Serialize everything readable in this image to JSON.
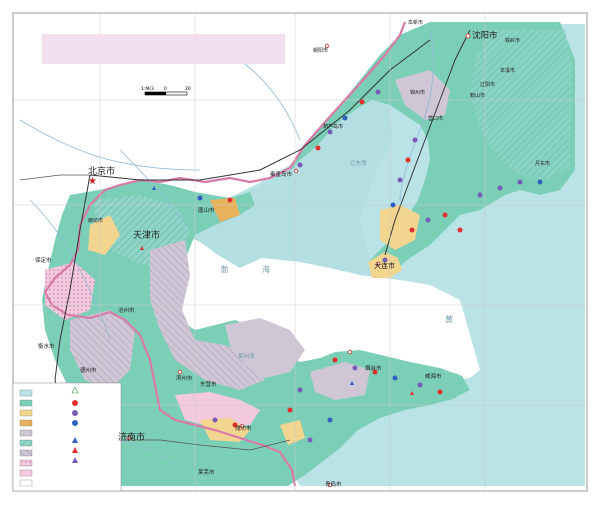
{
  "colors": {
    "sea": "#b9e3e6",
    "land_white": "#ffffff",
    "green": "#7ccfb7",
    "teal_hatch": "#8fd4c7",
    "grey_purple": "#cfc6d6",
    "pink": "#f3c9de",
    "yellow": "#f2d58e",
    "orange": "#e8b25d",
    "border_pink": "#d77aa8",
    "river": "#8fb8d8",
    "road": "#555555",
    "title_box": "#f4dff0"
  },
  "scale_bar": {
    "scale": "1:M(3",
    "ticks": [
      "0",
      "20"
    ]
  },
  "cities": {
    "shenyang": "沈阳市",
    "chaoyang": "朝阳市",
    "fuxin": "阜新市",
    "huludao": "葫芦岛市",
    "jinzhou": "锦州市",
    "yingkou": "营口市",
    "dalian": "大连市",
    "dandong": "丹东市",
    "benxi": "本溪市",
    "liaoyang": "辽阳市",
    "anshan": "鞍山市",
    "tieling": "铁岭市",
    "qinhuangdao": "秦皇岛市",
    "beijing": "北京市",
    "tianjin": "天津市",
    "langfang": "廊坊市",
    "tangshan": "唐山市",
    "baoding": "保定市",
    "cangzhou": "沧州市",
    "hengshui": "衡水市",
    "dezhou": "德州市",
    "binzhou": "滨州市",
    "dongying": "东营市",
    "weifang": "潍坊市",
    "yantai": "烟台市",
    "weihai": "威海市",
    "jinan": "济南市",
    "laiwu": "莱芜市",
    "qingdao": "青岛市"
  },
  "sea_labels": {
    "bohai_1": "渤",
    "bohai_2": "海",
    "huanghai": "黄",
    "liaodong_bay": "辽东湾",
    "laizhou_bay": "莱州湾"
  }
}
